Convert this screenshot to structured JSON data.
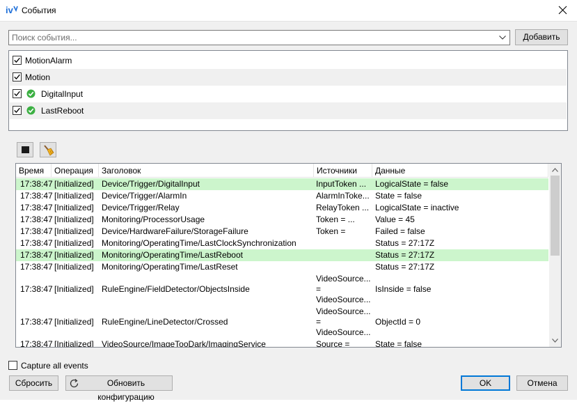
{
  "window": {
    "title": "События",
    "app_icon": "iv-logo-icon",
    "close_icon": "close-icon"
  },
  "search": {
    "placeholder": "Поиск события...",
    "value": "",
    "add_label": "Добавить"
  },
  "events": [
    {
      "label": "MotionAlarm",
      "checked": true,
      "status_icon": null
    },
    {
      "label": "Motion",
      "checked": true,
      "status_icon": null
    },
    {
      "label": "DigitalInput",
      "checked": true,
      "status_icon": "ok-green-check-icon"
    },
    {
      "label": "LastReboot",
      "checked": true,
      "status_icon": "ok-green-check-icon"
    }
  ],
  "toolbar": {
    "stop_icon": "stop-icon",
    "clear_icon": "broom-clear-icon"
  },
  "log": {
    "columns": [
      "Время",
      "Операция",
      "Заголовок",
      "Источники",
      "Данные"
    ],
    "rows": [
      [
        "17:38:47",
        "[Initialized]",
        "Device/Trigger/DigitalInput",
        "InputToken ...",
        "LogicalState = false"
      ],
      [
        "17:38:47",
        "[Initialized]",
        "Device/Trigger/AlarmIn",
        "AlarmInToke...",
        "State = false"
      ],
      [
        "17:38:47",
        "[Initialized]",
        "Device/Trigger/Relay",
        "RelayToken ...",
        "LogicalState = inactive"
      ],
      [
        "17:38:47",
        "[Initialized]",
        "Monitoring/ProcessorUsage",
        "Token = ...",
        "Value = 45"
      ],
      [
        "17:38:47",
        "[Initialized]",
        "Device/HardwareFailure/StorageFailure",
        "Token =",
        "Failed = false"
      ],
      [
        "17:38:47",
        "[Initialized]",
        "Monitoring/OperatingTime/LastClockSynchronization",
        "",
        "Status = 27:17Z"
      ],
      [
        "17:38:47",
        "[Initialized]",
        "Monitoring/OperatingTime/LastReboot",
        "",
        "Status = 27:17Z"
      ],
      [
        "17:38:47",
        "[Initialized]",
        "Monitoring/OperatingTime/LastReset",
        "",
        "Status = 27:17Z"
      ],
      [
        "17:38:47",
        "[Initialized]",
        "RuleEngine/FieldDetector/ObjectsInside",
        [
          "VideoSource...",
          "=",
          "VideoSource..."
        ],
        "IsInside = false"
      ],
      [
        "17:38:47",
        "[Initialized]",
        "RuleEngine/LineDetector/Crossed",
        [
          "VideoSource...",
          "=",
          "VideoSource..."
        ],
        "ObjectId = 0"
      ],
      [
        "17:38:47",
        "[Initialized]",
        "VideoSource/ImageTooDark/ImagingService",
        "Source =",
        "State = false"
      ]
    ],
    "highlight_color": "#ccf5cc",
    "highlighted_rows": [
      0,
      6
    ]
  },
  "capture_all": {
    "label": "Capture all events",
    "checked": false
  },
  "footer": {
    "reset_label": "Сбросить",
    "refresh_label": "Обновить конфигурацию",
    "refresh_icon": "refresh-icon",
    "ok_label": "OK",
    "cancel_label": "Отмена"
  },
  "colors": {
    "accent": "#0078d7",
    "ok_green": "#3cb043"
  }
}
